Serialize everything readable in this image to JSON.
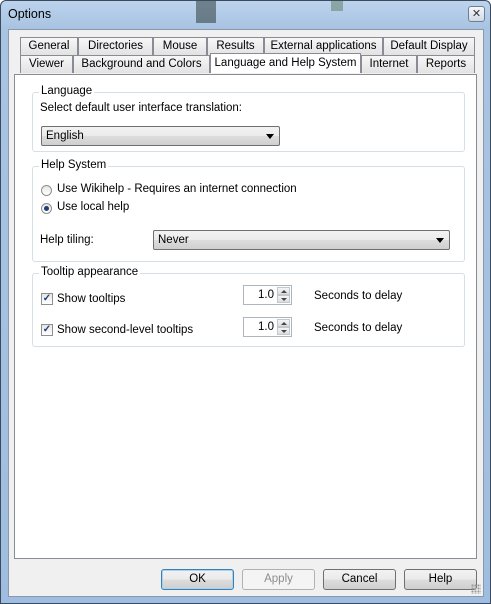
{
  "window": {
    "title": "Options",
    "close_glyph": "✕"
  },
  "tabs": {
    "row1": [
      "General",
      "Directories",
      "Mouse",
      "Results",
      "External applications",
      "Default Display"
    ],
    "row2": [
      "Viewer",
      "Background and Colors",
      "Language and Help System",
      "Internet",
      "Reports"
    ],
    "active": "Language and Help System"
  },
  "language": {
    "title": "Language",
    "prompt": "Select default user interface translation:",
    "selected": "English"
  },
  "help_system": {
    "title": "Help System",
    "option_wiki": "Use Wikihelp - Requires an internet connection",
    "option_local": "Use local help",
    "selected_option": "local",
    "tiling_label": "Help tiling:",
    "tiling_value": "Never"
  },
  "tooltip": {
    "title": "Tooltip appearance",
    "show_tooltips": {
      "label": "Show tooltips",
      "checked": true,
      "delay": "1.0",
      "delay_label": "Seconds to delay"
    },
    "show_second_level": {
      "label": "Show second-level tooltips",
      "checked": true,
      "delay": "1.0",
      "delay_label": "Seconds to delay"
    }
  },
  "buttons": {
    "ok": "OK",
    "apply": "Apply",
    "cancel": "Cancel",
    "help": "Help"
  },
  "icons": {
    "close": "close-icon",
    "dropdown": "chevron-down-icon",
    "check": "checkmark-icon",
    "grip": "resize-grip-icon"
  }
}
